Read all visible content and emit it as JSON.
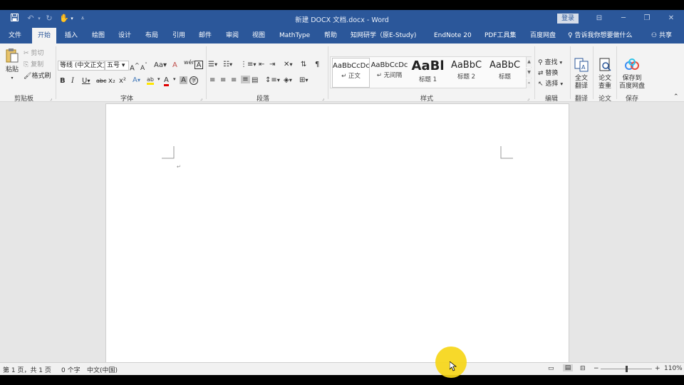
{
  "titlebar": {
    "doc_title": "新建 DOCX 文档.docx  -  Word",
    "login_label": "登录",
    "quick_access": {
      "save_icon": "save-icon",
      "undo_icon": "undo-icon",
      "redo_icon": "redo-icon",
      "touch_icon": "touch-mode-icon",
      "customize_icon": "customize-qat-icon"
    }
  },
  "tabs": [
    {
      "label": "文件"
    },
    {
      "label": "开始"
    },
    {
      "label": "插入"
    },
    {
      "label": "绘图"
    },
    {
      "label": "设计"
    },
    {
      "label": "布局"
    },
    {
      "label": "引用"
    },
    {
      "label": "邮件"
    },
    {
      "label": "审阅"
    },
    {
      "label": "视图"
    },
    {
      "label": "MathType"
    },
    {
      "label": "帮助"
    },
    {
      "label": "知网研学（原E-Study)"
    },
    {
      "label": "EndNote 20"
    },
    {
      "label": "PDF工具集"
    },
    {
      "label": "百度网盘"
    },
    {
      "label": "告诉我你想要做什么"
    },
    {
      "label": "共享"
    }
  ],
  "clipboard": {
    "paste": "粘贴",
    "cut": "剪切",
    "copy": "复制",
    "format_painter": "格式刷",
    "group": "剪贴板"
  },
  "font": {
    "font_name": "等线 (中文正文)",
    "font_size": "五号",
    "group": "字体",
    "bold": "B",
    "italic": "I",
    "underline": "U",
    "strikethrough": "abc",
    "subscript": "x₂",
    "superscript": "x²",
    "case": "Aa",
    "grow": "A",
    "shrink": "A",
    "clear": "A",
    "phonetic": "wén",
    "char_border": "A",
    "font_color": "A",
    "highlight": "ab",
    "shading": "A",
    "enclose": "字"
  },
  "paragraph": {
    "group": "段落"
  },
  "styles": {
    "group": "样式",
    "items": [
      {
        "sample": "AaBbCcDc",
        "name": "正文"
      },
      {
        "sample": "AaBbCcDc",
        "name": "无间隔"
      },
      {
        "sample": "AaBl",
        "name": "标题 1"
      },
      {
        "sample": "AaBbC",
        "name": "标题 2"
      },
      {
        "sample": "AaBbC",
        "name": "标题"
      }
    ]
  },
  "editing": {
    "find": "查找",
    "replace": "替换",
    "select": "选择",
    "group": "编辑"
  },
  "translate": {
    "label_line1": "全文",
    "label_line2": "翻译",
    "group": "翻译"
  },
  "paper": {
    "label_line1": "论文",
    "label_line2": "查重",
    "group": "论文"
  },
  "save_group": {
    "label_line1": "保存到",
    "label_line2": "百度网盘",
    "group": "保存"
  },
  "statusbar": {
    "page": "第 1 页，共 1 页",
    "words": "0 个字",
    "language": "中文(中国)",
    "zoom": "110%"
  },
  "colors": {
    "brand_blue": "#2b579a",
    "ribbon_bg": "#f3f3f3",
    "workspace_bg": "#e6e6e6",
    "cursor_highlight": "#f6d618"
  }
}
